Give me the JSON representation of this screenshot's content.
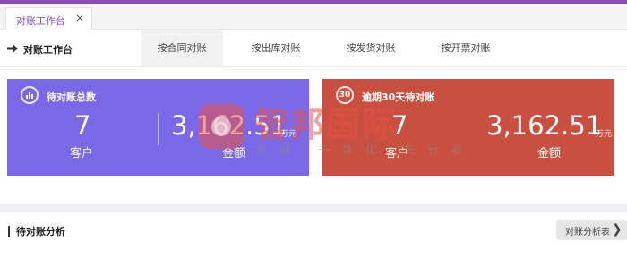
{
  "tabstrip": {
    "tab_label": "对账工作台",
    "close_glyph": "×"
  },
  "header": {
    "title": "对账工作台",
    "tabs": [
      {
        "label": "按合同对账",
        "active": true
      },
      {
        "label": "按出库对账",
        "active": false
      },
      {
        "label": "按发货对账",
        "active": false
      },
      {
        "label": "按开票对账",
        "active": false
      }
    ]
  },
  "pending_panel": {
    "title": "待对账总数",
    "color": "#7b68e6",
    "icon": "bar-chart-icon",
    "count": "7",
    "count_label": "客户",
    "amount": "3,162.51",
    "amount_unit": "万元",
    "amount_label": "金额"
  },
  "overdue_panel": {
    "title": "逾期30天待对账",
    "color": "#c95040",
    "badge": "30",
    "count": "7",
    "count_label": "客户",
    "amount": "3,162.51",
    "amount_unit": "万元",
    "amount_label": "金额"
  },
  "watermark": {
    "text": "智邦国际",
    "subtext": "数据·一体化·先行者"
  },
  "analysis": {
    "title": "待对账分析",
    "report_button": "对账分析表",
    "chevron": "❯"
  },
  "colors": {
    "accent": "#8a4bb8"
  }
}
